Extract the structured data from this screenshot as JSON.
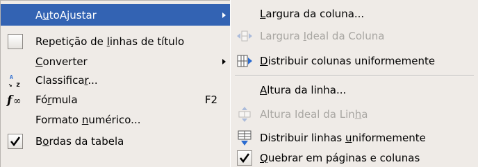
{
  "main_menu": {
    "items": [
      {
        "pre": "A",
        "acc": "u",
        "post": "toAjustar",
        "type": "submenu",
        "highlighted": true
      },
      {
        "pre": "Repetição de ",
        "acc": "l",
        "post": "inhas de título",
        "type": "checkbox",
        "checked": false
      },
      {
        "pre": "",
        "acc": "C",
        "post": "onverter",
        "type": "submenu"
      },
      {
        "pre": "Classifica",
        "acc": "r",
        "post": "...",
        "icon": "sort-az-icon"
      },
      {
        "pre": "Fó",
        "acc": "r",
        "post": "mula",
        "shortcut": "F2",
        "icon": "formula-fx-icon"
      },
      {
        "pre": "Formato ",
        "acc": "n",
        "post": "umérico...",
        "type": "plain"
      },
      {
        "pre": "B",
        "acc": "o",
        "post": "rdas da tabela",
        "type": "checkbox",
        "checked": true
      }
    ]
  },
  "submenu": {
    "items": [
      {
        "pre": "",
        "acc": "L",
        "post": "argura da coluna...",
        "enabled": true
      },
      {
        "pre": "Largura ",
        "acc": "I",
        "post": "deal da Coluna",
        "enabled": false,
        "icon": "optimal-column-width-icon"
      },
      {
        "pre": "",
        "acc": "D",
        "post": "istribuir colunas uniformemente",
        "enabled": true,
        "icon": "distribute-columns-icon"
      },
      {
        "pre": "",
        "acc": "A",
        "post": "ltura da linha...",
        "enabled": true
      },
      {
        "pre": "Altura Ideal da Lin",
        "acc": "h",
        "post": "a",
        "enabled": false,
        "icon": "optimal-row-height-icon"
      },
      {
        "pre": "Distribuir linhas ",
        "acc": "u",
        "post": "niformemente",
        "enabled": true,
        "icon": "distribute-rows-icon"
      },
      {
        "pre": "",
        "acc": "Q",
        "post": "uebrar em páginas e colunas",
        "enabled": true,
        "checked": true
      }
    ]
  },
  "colors": {
    "highlight": "#3363b3",
    "menu_bg": "#efebe7",
    "disabled_text": "#a8a6a2",
    "icon_blue": "#2a6bd0"
  }
}
